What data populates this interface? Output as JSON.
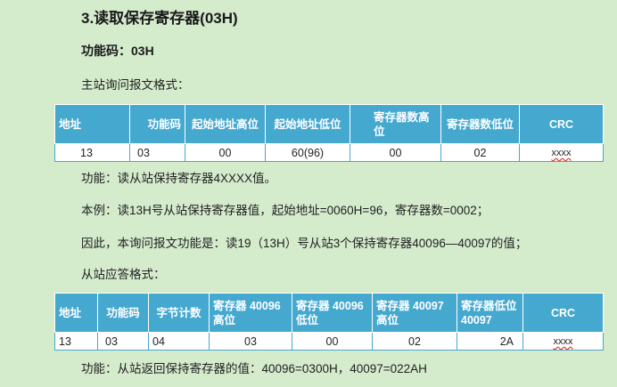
{
  "section_title": "3.读取保存寄存器(03H)",
  "function_code_label": "功能码：03H",
  "request_format_label": "主站询问报文格式：",
  "request_table": {
    "headers": [
      "地址",
      "功能码",
      "起始地址高位",
      "起始地址低位",
      "寄存器数高位",
      "寄存器数低位",
      "CRC"
    ],
    "row": [
      "13",
      "03",
      "00",
      "60(96)",
      "00",
      "02",
      "xxxx"
    ]
  },
  "request_function": "功能：读从站保持寄存器4XXXX值。",
  "example_text": "本例：读13H号从站保持寄存器值，起始地址=0060H=96，寄存器数=0002；",
  "therefore_text": "因此，本询问报文功能是：读19（13H）号从站3个保持寄存器40096—40097的值；",
  "response_format_label": "从站应答格式：",
  "response_table": {
    "headers": [
      "地址",
      "功能码",
      "字节计数",
      "寄存器 40096 高位",
      "寄存器 40096 低位",
      "寄存器 40097 高位",
      "寄存器低位 40097",
      "CRC"
    ],
    "row": [
      "13",
      "03",
      "04",
      "03",
      "00",
      "02",
      "2A",
      "xxxx"
    ]
  },
  "response_function": "功能：从站返回保持寄存器的值：40096=0300H，40097=022AH"
}
